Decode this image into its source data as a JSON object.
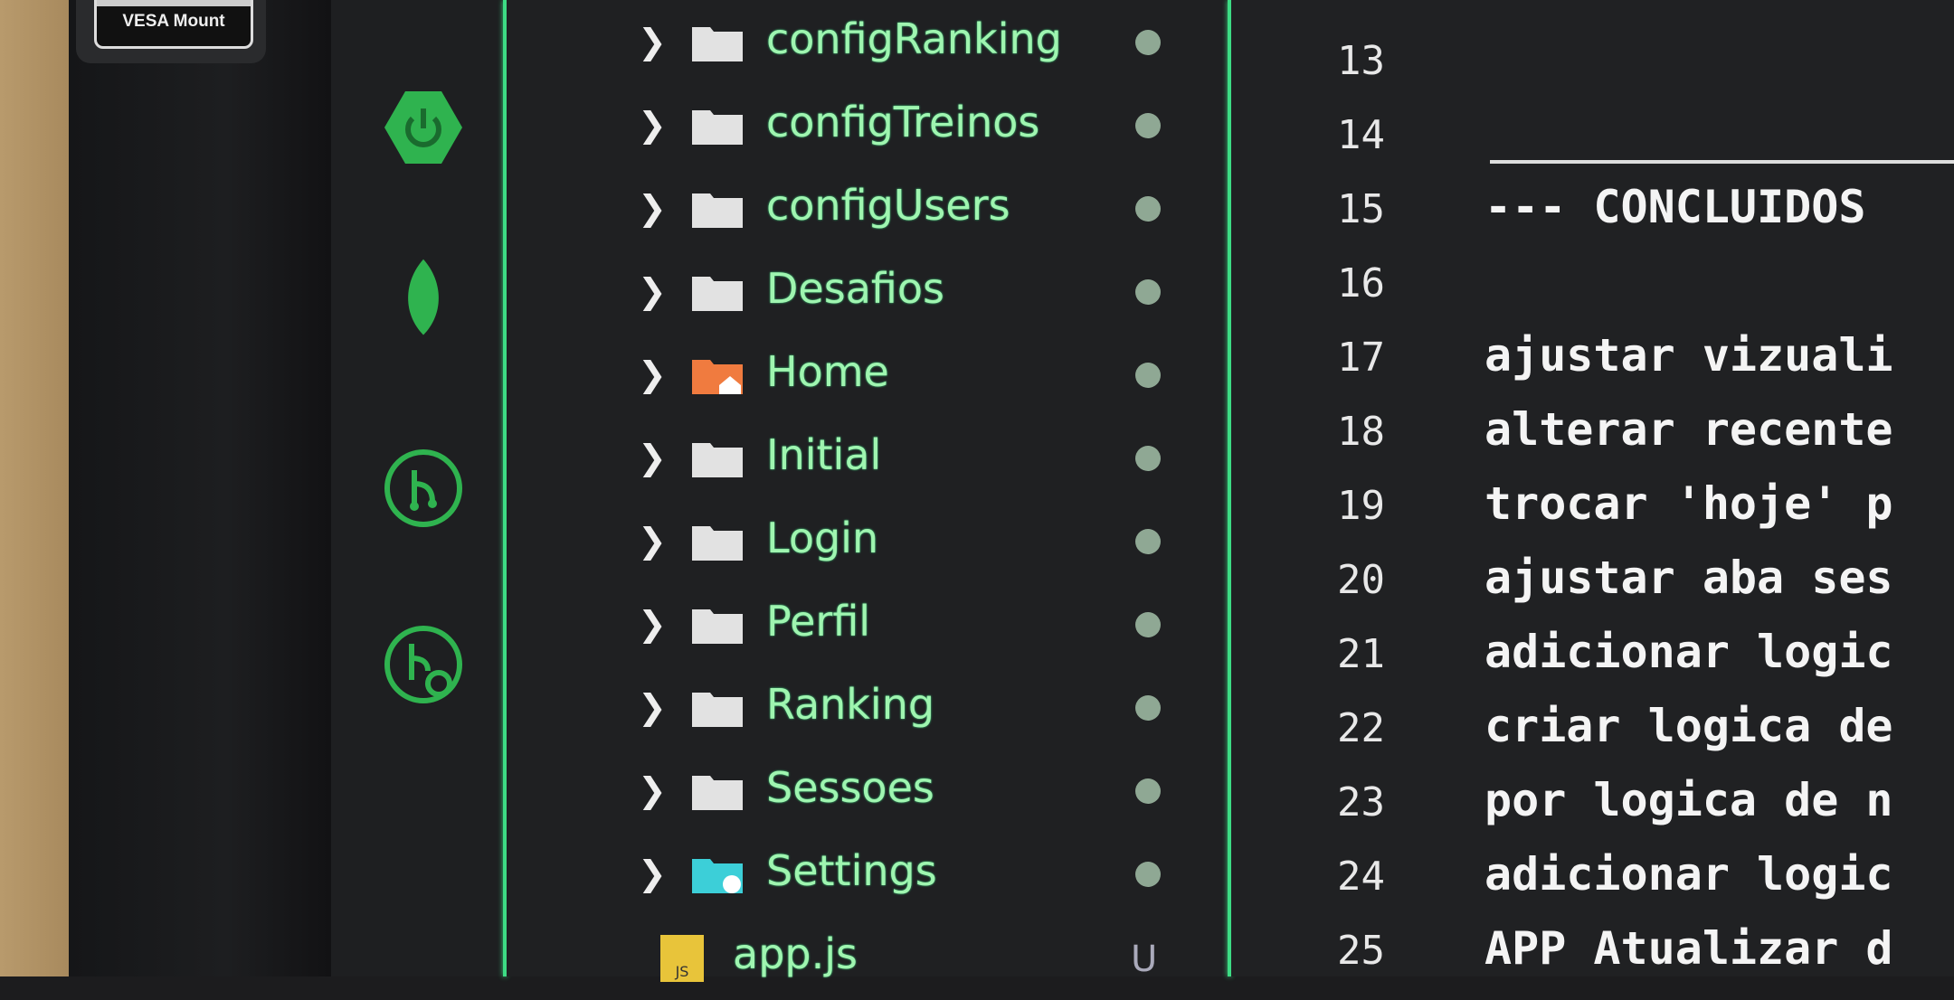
{
  "monitor": {
    "badge": "VESA Mount"
  },
  "activity_bar": {
    "icons": [
      "spring-boot-icon",
      "mongodb-leaf-icon",
      "git-graph-icon",
      "git-search-icon"
    ],
    "accent": "#3ddc84"
  },
  "explorer": {
    "items": [
      {
        "label": "configRanking",
        "type": "folder",
        "status": "dot"
      },
      {
        "label": "configTreinos",
        "type": "folder",
        "status": "dot"
      },
      {
        "label": "configUsers",
        "type": "folder",
        "status": "dot"
      },
      {
        "label": "Desafios",
        "type": "folder",
        "status": "dot"
      },
      {
        "label": "Home",
        "type": "folder-home",
        "status": "dot"
      },
      {
        "label": "Initial",
        "type": "folder",
        "status": "dot"
      },
      {
        "label": "Login",
        "type": "folder",
        "status": "dot"
      },
      {
        "label": "Perfil",
        "type": "folder",
        "status": "dot"
      },
      {
        "label": "Ranking",
        "type": "folder",
        "status": "dot"
      },
      {
        "label": "Sessoes",
        "type": "folder",
        "status": "dot"
      },
      {
        "label": "Settings",
        "type": "folder-settings",
        "status": "dot"
      },
      {
        "label": "app.js",
        "type": "js-file",
        "status": "U"
      }
    ]
  },
  "editor": {
    "lines": [
      {
        "n": "13",
        "text": ""
      },
      {
        "n": "14",
        "text": ""
      },
      {
        "n": "15",
        "text": "--- CONCLUIDOS"
      },
      {
        "n": "16",
        "text": ""
      },
      {
        "n": "17",
        "text": "ajustar vizuali"
      },
      {
        "n": "18",
        "text": "alterar recente"
      },
      {
        "n": "19",
        "text": "trocar 'hoje' p"
      },
      {
        "n": "20",
        "text": "ajustar aba ses"
      },
      {
        "n": "21",
        "text": "adicionar logic"
      },
      {
        "n": "22",
        "text": "criar logica de"
      },
      {
        "n": "23",
        "text": "por logica de n"
      },
      {
        "n": "24",
        "text": "adicionar logic"
      },
      {
        "n": "25",
        "text": "APP Atualizar d"
      }
    ]
  }
}
